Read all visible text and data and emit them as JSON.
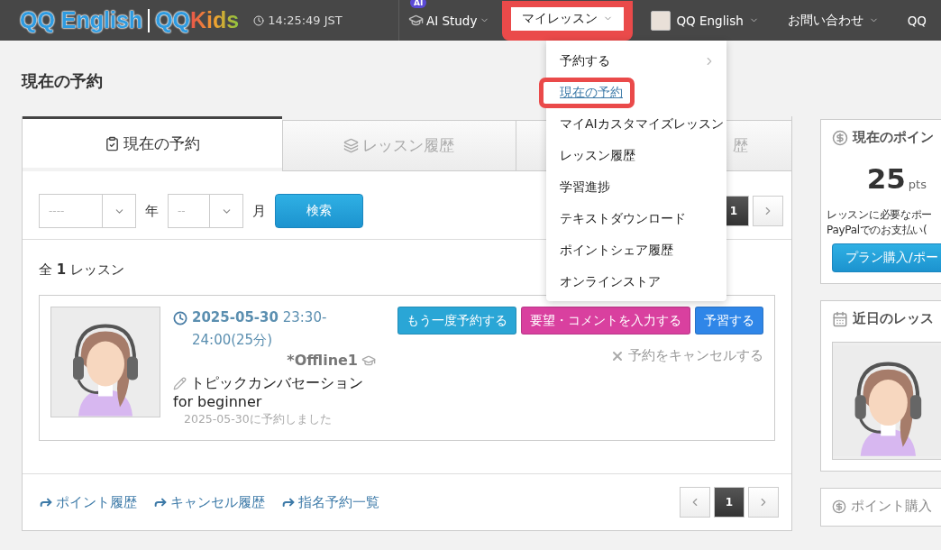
{
  "header": {
    "logo_main": "QQ English",
    "logo_qq": "QQ",
    "logo_kids": "Kids",
    "clock": "14:25:49 JST",
    "nav": [
      {
        "kind": "ai",
        "badge": "AI",
        "label": "AI Study",
        "selected": false
      },
      {
        "kind": "menu",
        "label": "マイレッスン",
        "selected": true
      },
      {
        "kind": "account",
        "label": "QQ English",
        "selected": false
      },
      {
        "kind": "menu",
        "label": "お問い合わせ",
        "selected": false
      },
      {
        "kind": "plain",
        "label": "QQ",
        "selected": false
      }
    ]
  },
  "dropdown": {
    "items": [
      {
        "label": "予約する",
        "kind": "submenu",
        "selected": false
      },
      {
        "label": "現在の予約",
        "kind": "link",
        "selected": true
      },
      {
        "label": "マイAIカスタマイズレッスン",
        "kind": "link",
        "selected": false
      },
      {
        "label": "レッスン履歴",
        "kind": "link",
        "selected": false
      },
      {
        "label": "学習進捗",
        "kind": "link",
        "selected": false
      },
      {
        "label": "テキストダウンロード",
        "kind": "link",
        "selected": false
      },
      {
        "label": "ポイントシェア履歴",
        "kind": "link",
        "selected": false
      },
      {
        "label": "オンラインストア",
        "kind": "link",
        "selected": false
      }
    ]
  },
  "page_title": "現在の予約",
  "tabs": [
    {
      "label": "現在の予約",
      "selected": true
    },
    {
      "label": "レッスン履歴",
      "selected": false
    },
    {
      "label": "歴",
      "selected": false
    }
  ],
  "filters": {
    "year_placeholder": "----",
    "year_unit": "年",
    "month_placeholder": "--",
    "month_unit": "月",
    "search_button": "検索"
  },
  "pagination_top": {
    "next": true,
    "pages": [
      {
        "label": "1",
        "selected": true
      }
    ]
  },
  "count": "全 **1** レッスン",
  "lesson": {
    "datetime": "**2025-05-30** 23:30-24:00(25分)",
    "room": "*Offline1",
    "course": "トピックカンバセーション",
    "level": "for beginner",
    "booked": "2025-05-30に予約しました",
    "buttons": [
      {
        "label": "もう一度予約する",
        "color": "#2aa6d6"
      },
      {
        "label": "要望・コメントを入力する",
        "color": "#d9409f"
      },
      {
        "label": "予習する",
        "color": "#2f86e8"
      }
    ],
    "cancel": "予約をキャンセルする"
  },
  "footer_links": [
    "ポイント履歴",
    "キャンセル履歴",
    "指名予約一覧"
  ],
  "pagination_bottom": {
    "prev": true,
    "next": true,
    "pages": [
      {
        "label": "1",
        "selected": true
      }
    ]
  },
  "sidebar": {
    "points_title": "現在のポイン",
    "points": "25",
    "points_unit": "pts",
    "points_note": [
      "レッスンに必要なポー",
      "PayPalでのお支払い("
    ],
    "points_button": "プラン購入/ポー",
    "upcoming_title": "近日のレッス",
    "purchase_title": "ポイント購入"
  }
}
